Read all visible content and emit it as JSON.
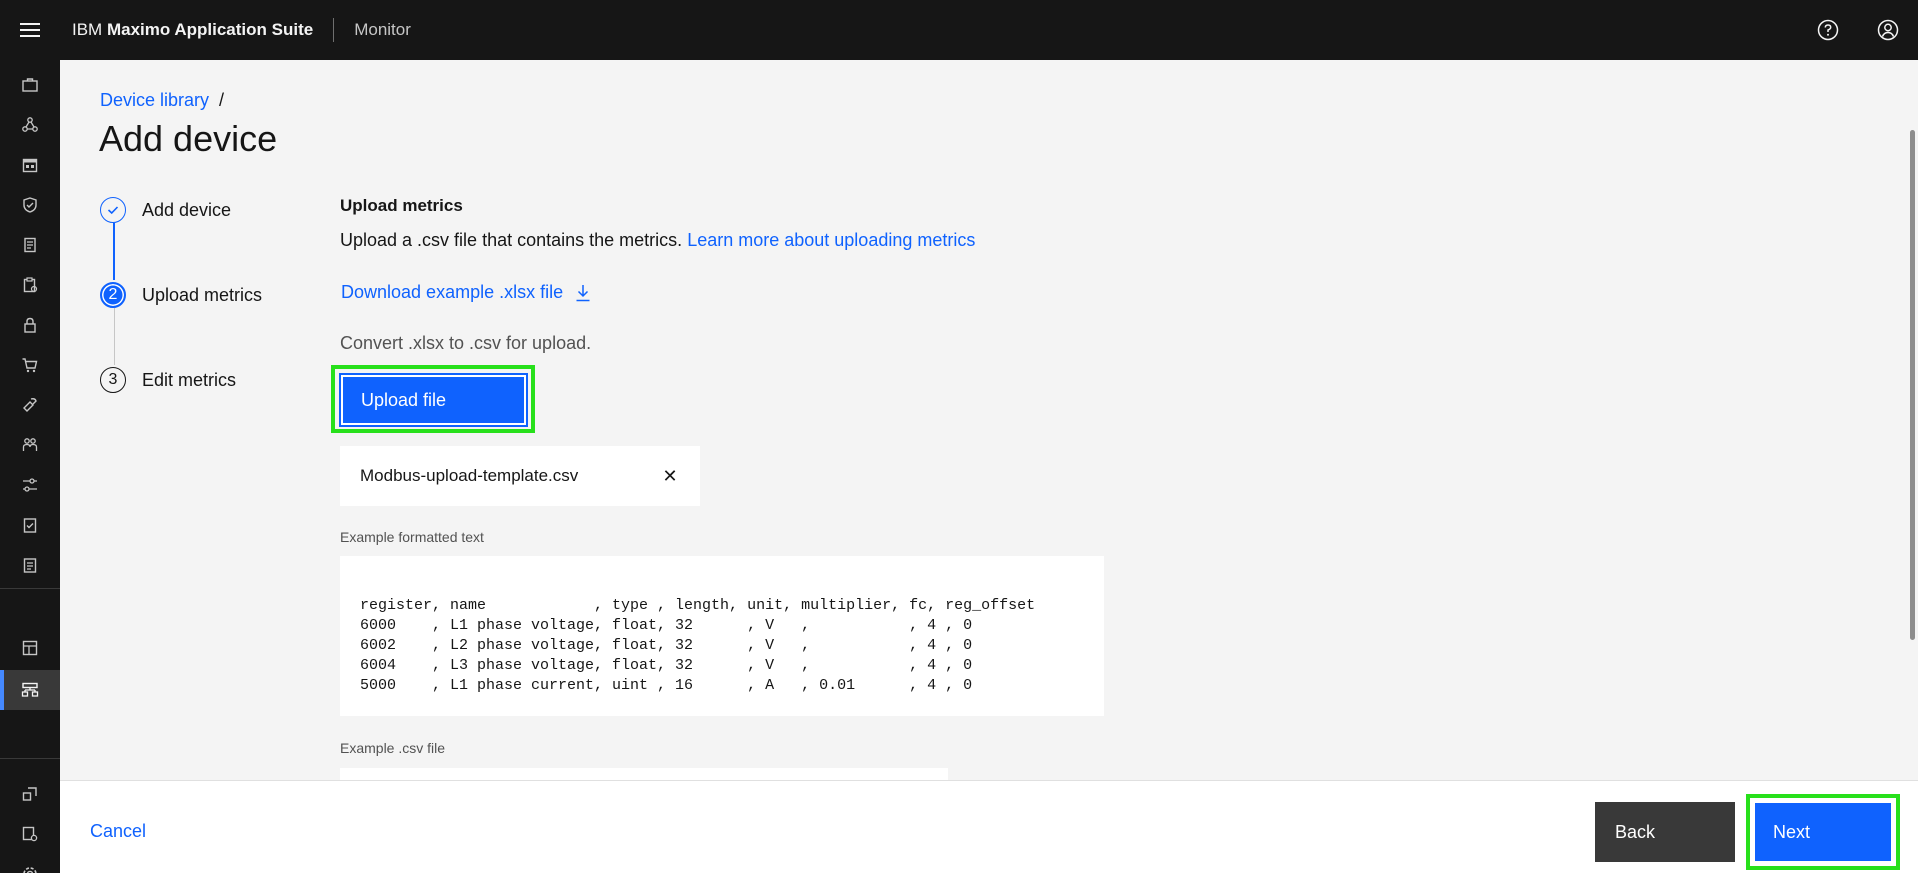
{
  "header": {
    "brand_prefix": "IBM",
    "brand_name": "Maximo Application Suite",
    "product": "Monitor",
    "icons": [
      "hamburger-icon",
      "help-icon",
      "user-profile-icon"
    ]
  },
  "rail": {
    "icons": [
      "briefcase-icon",
      "network-icon",
      "calendar-icon",
      "shield-check-icon",
      "document-icon",
      "clipboard-icon",
      "lock-icon",
      "cart-icon",
      "tools-icon",
      "people-icon",
      "sliders-icon",
      "checklist-icon",
      "report-icon",
      "dashboard-icon",
      "device-hierarchy-icon",
      "launch-icon",
      "settings-check-icon",
      "gear-icon"
    ],
    "active": "device-hierarchy-icon"
  },
  "breadcrumb": {
    "parent": "Device library",
    "separator": "/"
  },
  "page": {
    "title": "Add device"
  },
  "steps": [
    {
      "number": "✓",
      "label": "Add device",
      "state": "complete"
    },
    {
      "number": "2",
      "label": "Upload metrics",
      "state": "current"
    },
    {
      "number": "3",
      "label": "Edit metrics",
      "state": "incomplete"
    }
  ],
  "content": {
    "title": "Upload metrics",
    "description": "Upload a .csv file that contains the metrics.",
    "learn_more": "Learn more about uploading metrics",
    "download_link": "Download example .xlsx file",
    "convert_note": "Convert .xlsx to .csv for upload.",
    "upload_button": "Upload file",
    "file_name": "Modbus-upload-template.csv",
    "file_close": "✕",
    "example_text_label": "Example formatted text",
    "example_text": "register, name            , type , length, unit, multiplier, fc, reg_offset\n6000    , L1 phase voltage, float, 32      , V   ,           , 4 , 0\n6002    , L2 phase voltage, float, 32      , V   ,           , 4 , 0\n6004    , L3 phase voltage, float, 32      , V   ,           , 4 , 0\n5000    , L1 phase current, uint , 16      , A   , 0.01      , 4 , 0",
    "example_csv_label": "Example .csv file"
  },
  "footer": {
    "cancel": "Cancel",
    "back": "Back",
    "next": "Next"
  },
  "colors": {
    "primary": "#0f62fe",
    "header_bg": "#161616",
    "highlight": "#27e01b",
    "secondary_button": "#393939"
  }
}
